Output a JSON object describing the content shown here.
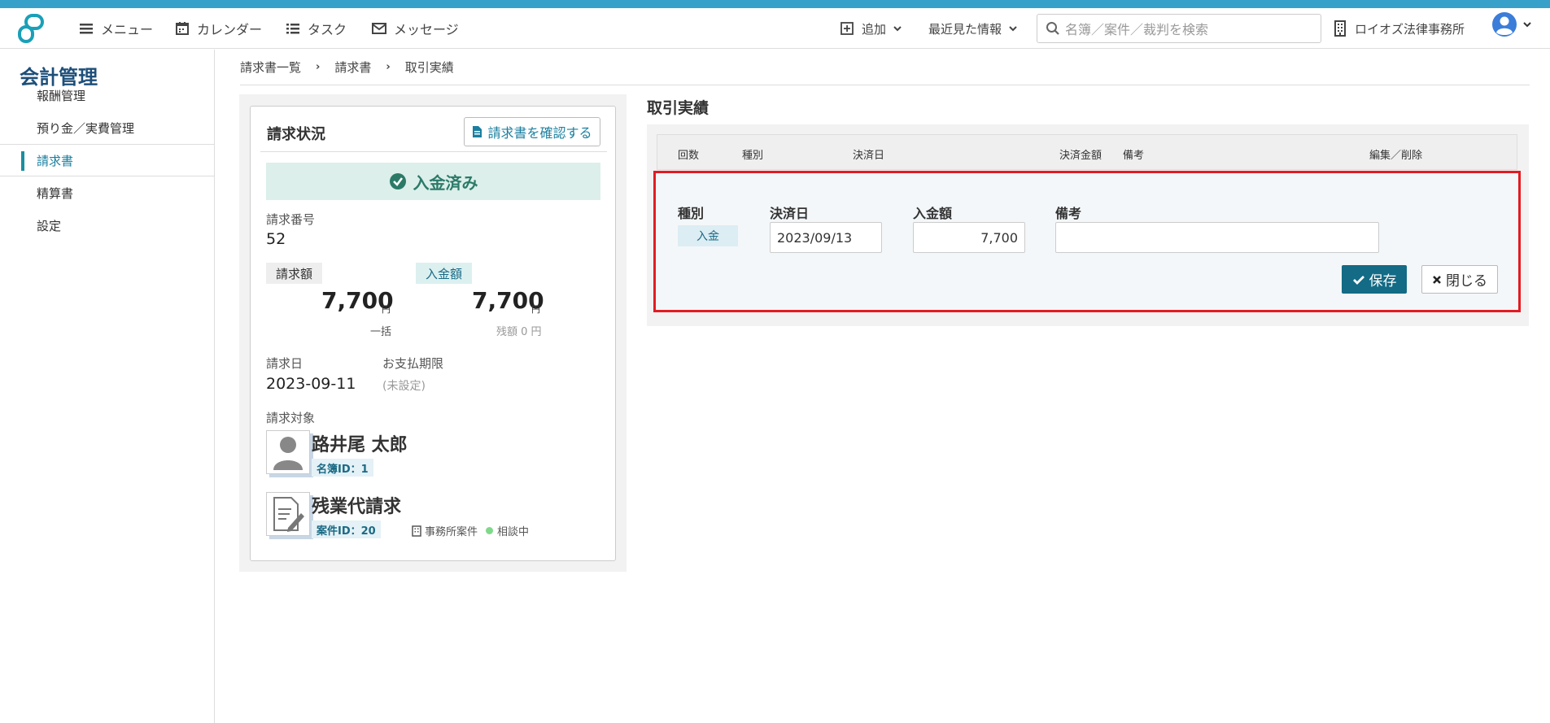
{
  "nav": {
    "menu": "メニュー",
    "calendar": "カレンダー",
    "task": "タスク",
    "message": "メッセージ",
    "add": "追加",
    "recent": "最近見た情報",
    "search_placeholder": "名簿／案件／裁判を検索",
    "office": "ロイオズ法律事務所"
  },
  "sidebar": {
    "title": "会計管理",
    "items": [
      {
        "label": "報酬管理"
      },
      {
        "label": "預り金／実費管理"
      },
      {
        "label": "請求書"
      },
      {
        "label": "精算書"
      },
      {
        "label": "設定"
      }
    ]
  },
  "breadcrumb": [
    "請求書一覧",
    "請求書",
    "取引実績"
  ],
  "invoice": {
    "title": "請求状況",
    "confirm_button": "請求書を確認する",
    "status": "入金済み",
    "number_label": "請求番号",
    "number": "52",
    "billed_tag": "請求額",
    "paid_tag": "入金額",
    "billed_amount": "7,700",
    "paid_amount": "7,700",
    "yen": "円",
    "billed_note": "一括",
    "balance_note": "残額 0 円",
    "date_label": "請求日",
    "date": "2023-09-11",
    "due_label": "お支払期限",
    "due": "(未設定)",
    "target_label": "請求対象",
    "person_name": "路井尾 太郎",
    "person_id": "名簿ID：1",
    "case_name": "残業代請求",
    "case_id": "案件ID：20",
    "case_type": "事務所案件",
    "case_status": "相談中"
  },
  "transactions": {
    "title": "取引実績",
    "headers": {
      "round": "回数",
      "kind": "種別",
      "date": "決済日",
      "amount": "決済金額",
      "note": "備考",
      "edit": "編集／削除"
    },
    "form": {
      "kind_label": "種別",
      "kind_value": "入金",
      "date_label": "決済日",
      "date_value": "2023/09/13",
      "amount_label": "入金額",
      "amount_value": "7,700",
      "note_label": "備考",
      "note_value": "",
      "save": "保存",
      "close": "閉じる"
    }
  },
  "colors": {
    "accent": "#136b85",
    "paid_bg": "#dcefea",
    "highlight": "#e31b23"
  }
}
